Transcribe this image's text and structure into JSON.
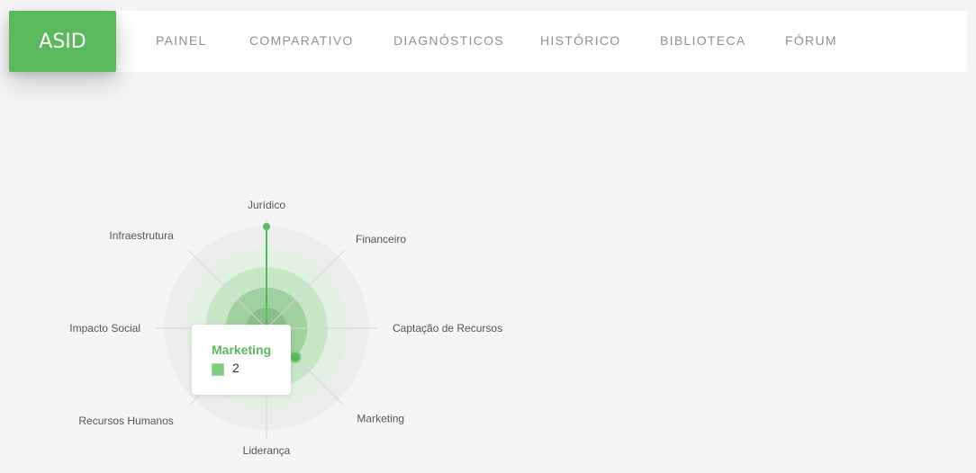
{
  "app": {
    "brand": "ASID",
    "accent": "#5cb85c"
  },
  "nav": {
    "items": [
      {
        "label": "PAINEL"
      },
      {
        "label": "COMPARATIVO"
      },
      {
        "label": "DIAGNÓSTICOS"
      },
      {
        "label": "HISTÓRICO"
      },
      {
        "label": "BIBLIOTECA"
      },
      {
        "label": "FÓRUM"
      }
    ]
  },
  "chart_data": {
    "type": "radar",
    "categories": [
      "Jurídico",
      "Financeiro",
      "Captação de Recursos",
      "Marketing",
      "Liderança",
      "Recursos Humanos",
      "Impacto Social",
      "Infraestrutura"
    ],
    "series": [
      {
        "values": [
          5,
          0,
          0,
          2,
          0,
          0,
          0,
          0
        ]
      }
    ],
    "rmax": 5,
    "levels": 5,
    "color": "#5cb85c"
  },
  "tooltip": {
    "title": "Marketing",
    "value": "2"
  }
}
